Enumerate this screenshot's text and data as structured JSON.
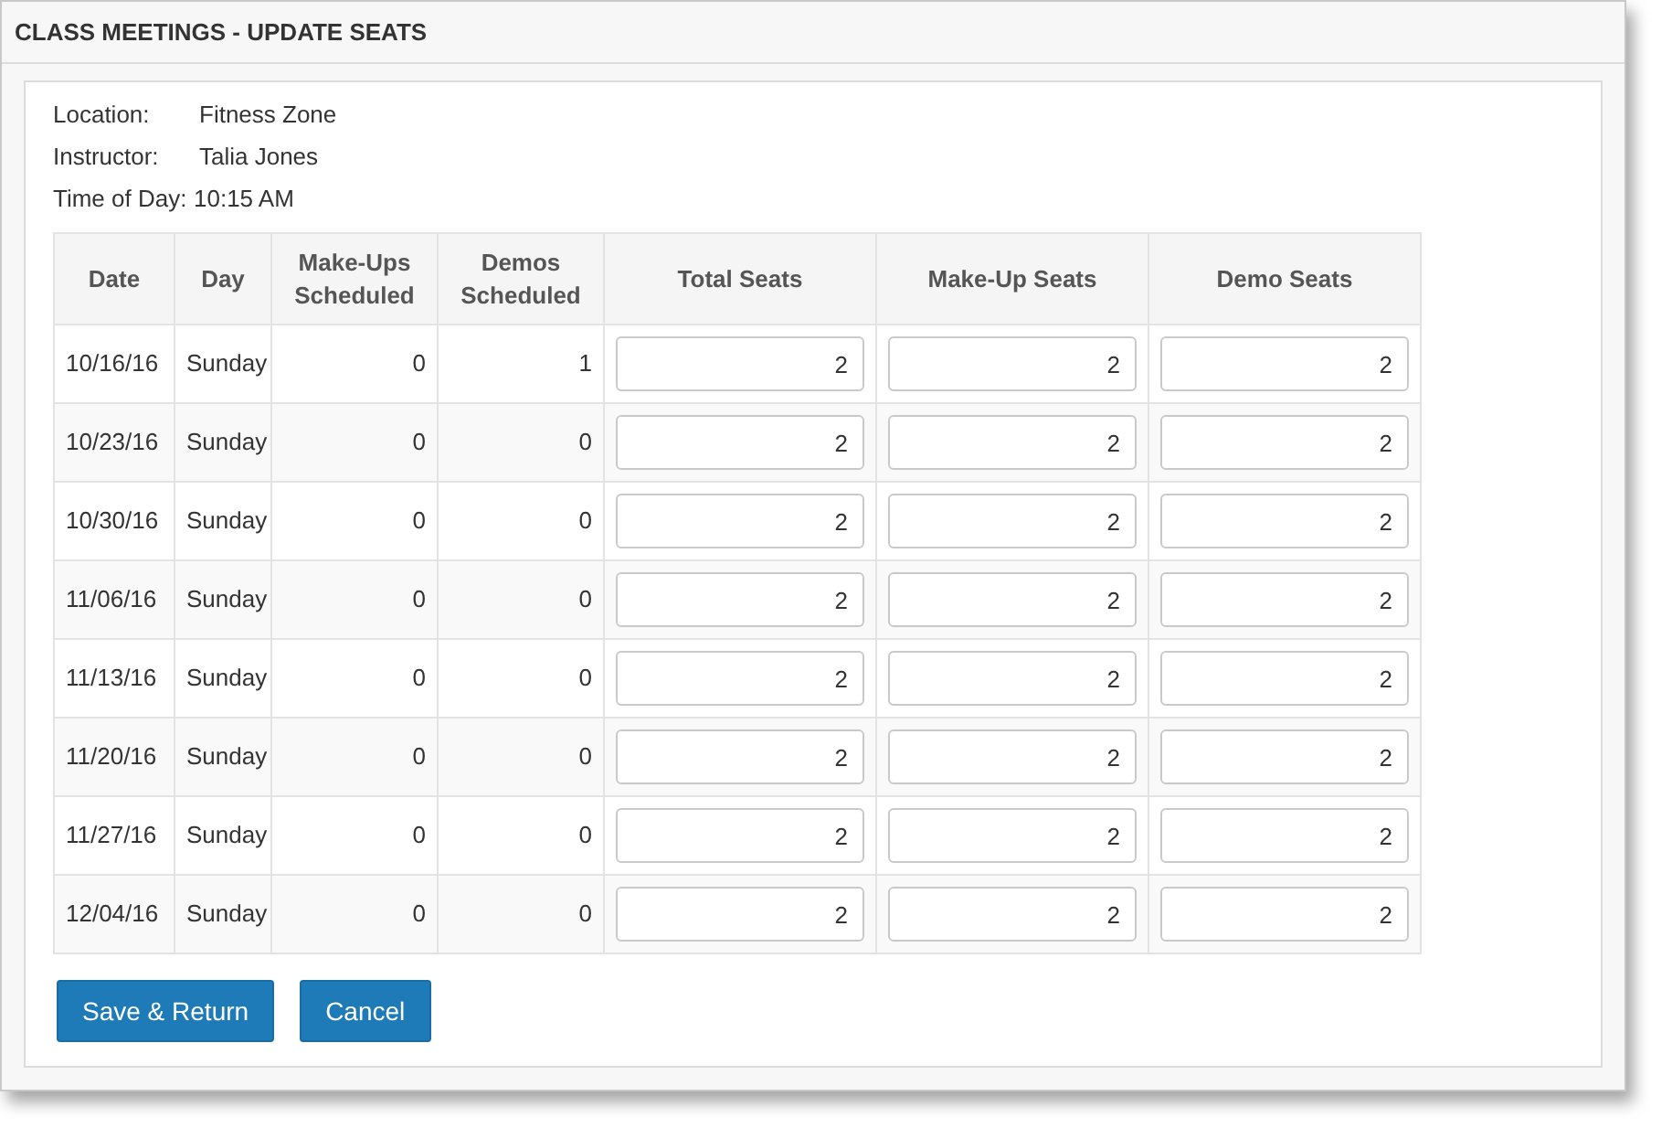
{
  "window": {
    "title": "CLASS MEETINGS - UPDATE SEATS"
  },
  "info": [
    {
      "label": "Location:",
      "value": "Fitness Zone"
    },
    {
      "label": "Instructor:",
      "value": "Talia Jones"
    },
    {
      "label": "Time of Day:",
      "value": "10:15 AM"
    }
  ],
  "table": {
    "columns": [
      "Date",
      "Day",
      "Make-Ups Scheduled",
      "Demos Scheduled",
      "Total Seats",
      "Make-Up Seats",
      "Demo Seats"
    ],
    "rows": [
      {
        "date": "10/16/16",
        "day": "Sunday",
        "makeups": "0",
        "demos": "1",
        "total": "2",
        "makeup_seats": "2",
        "demo_seats": "2"
      },
      {
        "date": "10/23/16",
        "day": "Sunday",
        "makeups": "0",
        "demos": "0",
        "total": "2",
        "makeup_seats": "2",
        "demo_seats": "2"
      },
      {
        "date": "10/30/16",
        "day": "Sunday",
        "makeups": "0",
        "demos": "0",
        "total": "2",
        "makeup_seats": "2",
        "demo_seats": "2"
      },
      {
        "date": "11/06/16",
        "day": "Sunday",
        "makeups": "0",
        "demos": "0",
        "total": "2",
        "makeup_seats": "2",
        "demo_seats": "2"
      },
      {
        "date": "11/13/16",
        "day": "Sunday",
        "makeups": "0",
        "demos": "0",
        "total": "2",
        "makeup_seats": "2",
        "demo_seats": "2"
      },
      {
        "date": "11/20/16",
        "day": "Sunday",
        "makeups": "0",
        "demos": "0",
        "total": "2",
        "makeup_seats": "2",
        "demo_seats": "2"
      },
      {
        "date": "11/27/16",
        "day": "Sunday",
        "makeups": "0",
        "demos": "0",
        "total": "2",
        "makeup_seats": "2",
        "demo_seats": "2"
      },
      {
        "date": "12/04/16",
        "day": "Sunday",
        "makeups": "0",
        "demos": "0",
        "total": "2",
        "makeup_seats": "2",
        "demo_seats": "2"
      }
    ]
  },
  "buttons": [
    "Save & Return",
    "Cancel"
  ]
}
